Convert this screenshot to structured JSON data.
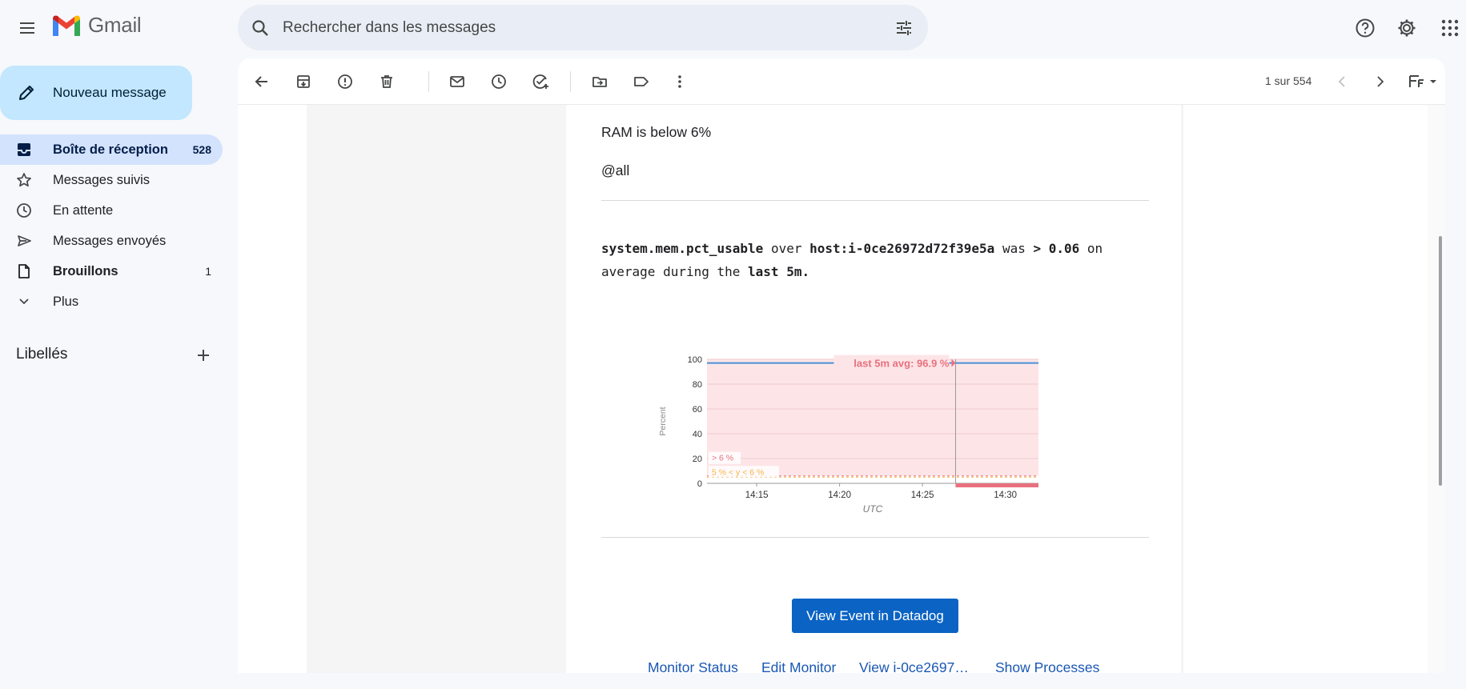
{
  "app": {
    "name": "Gmail"
  },
  "search": {
    "placeholder": "Rechercher dans les messages"
  },
  "sidebar": {
    "compose_label": "Nouveau message",
    "items": [
      {
        "label": "Boîte de réception",
        "count": "528",
        "icon": "inbox-icon"
      },
      {
        "label": "Messages suivis",
        "count": "",
        "icon": "star-icon"
      },
      {
        "label": "En attente",
        "count": "",
        "icon": "clock-icon"
      },
      {
        "label": "Messages envoyés",
        "count": "",
        "icon": "send-icon"
      },
      {
        "label": "Brouillons",
        "count": "1",
        "icon": "draft-icon"
      },
      {
        "label": "Plus",
        "count": "",
        "icon": "chevron-down-icon"
      }
    ],
    "labels_title": "Libellés"
  },
  "toolbar": {
    "pager": "1 sur 554"
  },
  "email": {
    "line1": "RAM is below 6%",
    "line2": "@all",
    "query": {
      "metric": "system.mem.pct_usable",
      "w_over": "over",
      "host": "host:i-0ce26972d72f39e5a",
      "w_was": "was",
      "threshold": "> 0.06",
      "w_on": "on",
      "w_avg": "average during the",
      "window": "last 5m."
    },
    "button_label": "View Event in Datadog",
    "links": [
      "Monitor Status",
      "Edit Monitor",
      "View i-0ce2697…",
      "Show Processes"
    ]
  },
  "chart_data": {
    "type": "line",
    "ylabel": "Percent",
    "xlabel": "UTC",
    "ylim": [
      0,
      100
    ],
    "yticks": [
      0,
      20,
      40,
      60,
      80,
      100
    ],
    "xticks": [
      "14:15",
      "14:20",
      "14:25",
      "14:30"
    ],
    "annotation": "last 5m avg: 96.9 %",
    "threshold_labels": [
      "> 6 %",
      "5 % < y < 6 %"
    ],
    "series": [
      {
        "x": [
          "14:12",
          "14:15",
          "14:20",
          "14:25",
          "14:27",
          "14:30",
          "14:32"
        ],
        "values": [
          97,
          97,
          97,
          97,
          97,
          97,
          97
        ]
      }
    ],
    "colors": {
      "line": "#4a90d9",
      "alert_zone": "#fde5e7",
      "threshold": "#e8707f",
      "warning": "#f5b342"
    }
  }
}
